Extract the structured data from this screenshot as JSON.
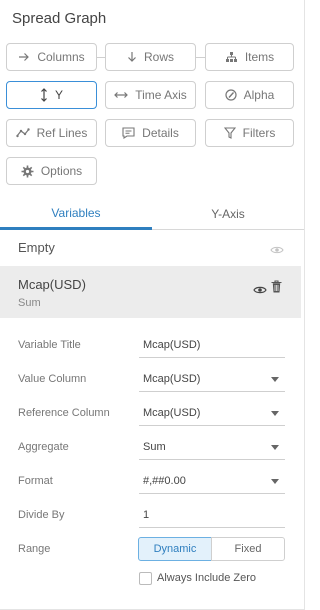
{
  "panel": {
    "title": "Spread Graph"
  },
  "buttons": {
    "columns": "Columns",
    "rows": "Rows",
    "items": "Items",
    "y": "Y",
    "time_axis": "Time Axis",
    "alpha": "Alpha",
    "ref_lines": "Ref Lines",
    "details": "Details",
    "filters": "Filters",
    "options": "Options"
  },
  "tabs": {
    "variables": "Variables",
    "y_axis": "Y-Axis"
  },
  "variables": {
    "empty_label": "Empty",
    "selected": {
      "label": "Mcap(USD)",
      "aggregate": "Sum"
    }
  },
  "properties": {
    "variable_title": {
      "label": "Variable Title",
      "value": "Mcap(USD)"
    },
    "value_column": {
      "label": "Value Column",
      "value": "Mcap(USD)"
    },
    "reference_column": {
      "label": "Reference Column",
      "value": "Mcap(USD)"
    },
    "aggregate": {
      "label": "Aggregate",
      "value": "Sum"
    },
    "format": {
      "label": "Format",
      "value": "#,##0.00"
    },
    "divide_by": {
      "label": "Divide By",
      "value": "1"
    },
    "range": {
      "label": "Range",
      "options": [
        "Dynamic",
        "Fixed"
      ],
      "selected": "Dynamic"
    },
    "always_include_zero": {
      "label": "Always Include Zero",
      "checked": false
    }
  },
  "colors": {
    "accent": "#2f7fbf",
    "active_border": "#3a8fd8",
    "selected_row_bg": "#ececec"
  }
}
